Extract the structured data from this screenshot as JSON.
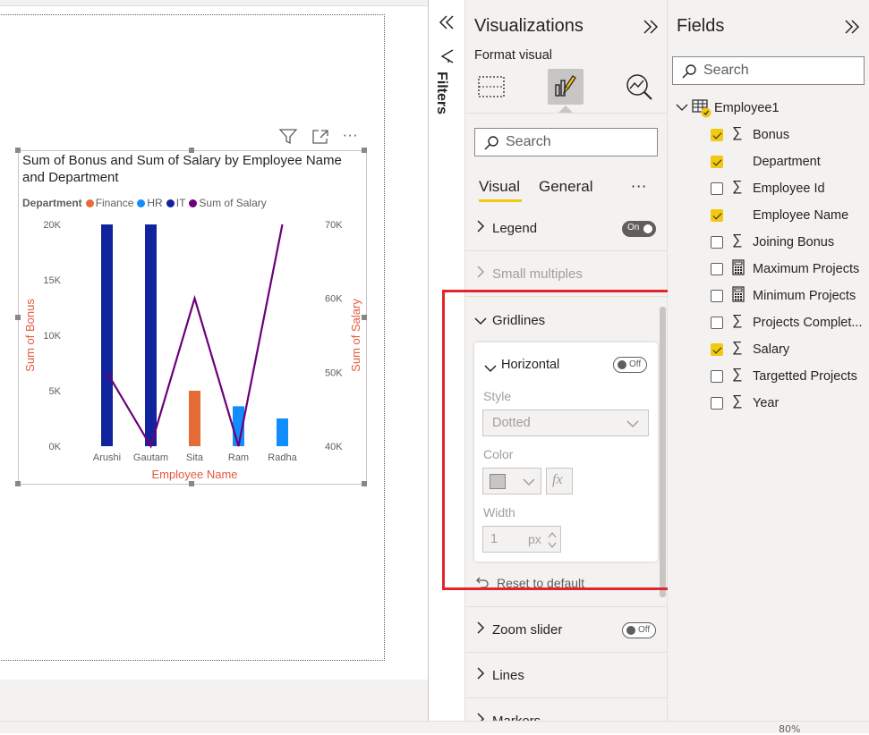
{
  "canvas": {
    "status_right": "80%"
  },
  "visual_header": {
    "filter_icon": "funnel-icon",
    "focus_icon": "focus-mode-icon",
    "more_icon": "more-options-icon",
    "more_label": "···"
  },
  "chart_data": {
    "type": "bar+line",
    "title": "Sum of Bonus and Sum of Salary by Employee Name and Department",
    "legend_title": "Department",
    "legend_placement": "top-left",
    "categories": [
      "Arushi",
      "Gautam",
      "Sita",
      "Ram",
      "Radha"
    ],
    "xlabel": "Employee Name",
    "ylabel": "Sum of Bonus",
    "y2label": "Sum of Salary",
    "ylim": [
      0,
      20000
    ],
    "y2lim": [
      40000,
      70000
    ],
    "yticks": [
      "0K",
      "5K",
      "10K",
      "15K",
      "20K"
    ],
    "y2ticks": [
      "40K",
      "50K",
      "60K",
      "70K"
    ],
    "gridlines": false,
    "series": [
      {
        "name": "Finance",
        "kind": "bar",
        "color": "#e66c37",
        "values": [
          null,
          null,
          5000,
          null,
          null
        ]
      },
      {
        "name": "HR",
        "kind": "bar",
        "color": "#118dff",
        "values": [
          null,
          null,
          null,
          3600,
          2500
        ]
      },
      {
        "name": "IT",
        "kind": "bar",
        "color": "#12239e",
        "values": [
          20000,
          20000,
          null,
          null,
          null
        ]
      },
      {
        "name": "Sum of Salary",
        "kind": "line",
        "axis": "y2",
        "color": "#6b007b",
        "values": [
          50000,
          40000,
          60000,
          40000,
          70000
        ]
      }
    ],
    "axis_title_color": "#e3593c"
  },
  "filters": {
    "label": "Filters",
    "collapse_icon": "double-chevron-left-icon",
    "filter_icon": "funnel-outline-icon"
  },
  "viz": {
    "title": "Visualizations",
    "expand_icon": "double-chevron-right-icon",
    "format_label": "Format visual",
    "search_placeholder": "Search",
    "tab_visual": "Visual",
    "tab_general": "General",
    "tab_more": "···",
    "sections": {
      "legend": "Legend",
      "legend_toggle": "On",
      "small_multiples": "Small multiples",
      "gridlines": "Gridlines",
      "horizontal": "Horizontal",
      "horizontal_toggle": "Off",
      "style_label": "Style",
      "style_value": "Dotted",
      "color_label": "Color",
      "fx": "fx",
      "width_label": "Width",
      "width_value": "1",
      "width_unit": "px",
      "reset": "Reset to default",
      "zoom_slider": "Zoom slider",
      "zoom_toggle": "Off",
      "lines": "Lines",
      "markers": "Markers"
    }
  },
  "fields": {
    "title": "Fields",
    "expand_icon": "double-chevron-right-icon",
    "search_placeholder": "Search",
    "table_name": "Employee1",
    "items": [
      {
        "name": "Bonus",
        "checked": true,
        "type": "sum"
      },
      {
        "name": "Department",
        "checked": true,
        "type": "text"
      },
      {
        "name": "Employee Id",
        "checked": false,
        "type": "sum"
      },
      {
        "name": "Employee Name",
        "checked": true,
        "type": "text"
      },
      {
        "name": "Joining Bonus",
        "checked": false,
        "type": "sum"
      },
      {
        "name": "Maximum Projects",
        "checked": false,
        "type": "calc"
      },
      {
        "name": "Minimum Projects",
        "checked": false,
        "type": "calc"
      },
      {
        "name": "Projects Complet...",
        "checked": false,
        "type": "sum"
      },
      {
        "name": "Salary",
        "checked": true,
        "type": "sum"
      },
      {
        "name": "Targetted Projects",
        "checked": false,
        "type": "sum"
      },
      {
        "name": "Year",
        "checked": false,
        "type": "sum"
      }
    ]
  },
  "colors": {
    "accent": "#f2c811",
    "highlight": "#e3242b"
  }
}
